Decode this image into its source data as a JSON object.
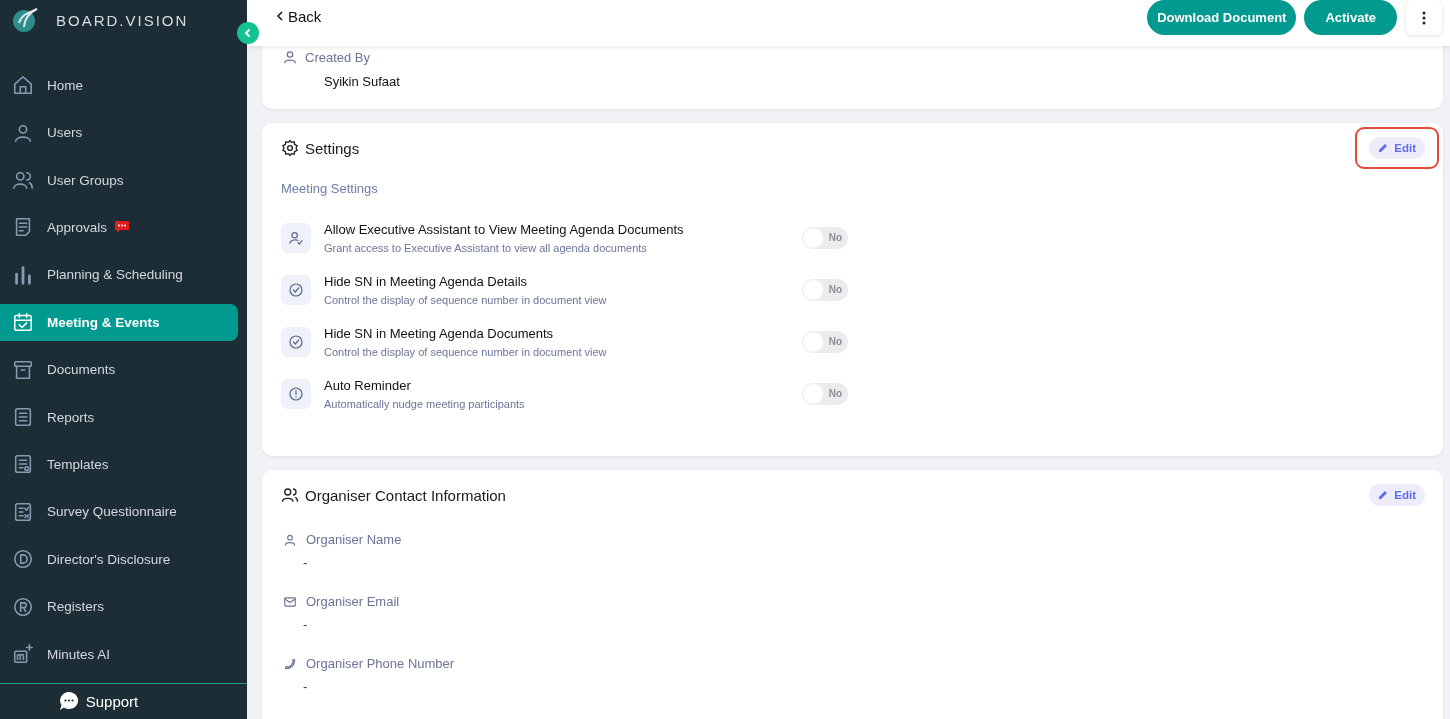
{
  "brand": {
    "name": "BOARD.VISION"
  },
  "sidebar": {
    "items": [
      {
        "label": "Home",
        "selected": false,
        "badge": false
      },
      {
        "label": "Users",
        "selected": false,
        "badge": false
      },
      {
        "label": "User Groups",
        "selected": false,
        "badge": false
      },
      {
        "label": "Approvals",
        "selected": false,
        "badge": true
      },
      {
        "label": "Planning & Scheduling",
        "selected": false,
        "badge": false
      },
      {
        "label": "Meeting & Events",
        "selected": true,
        "badge": false
      },
      {
        "label": "Documents",
        "selected": false,
        "badge": false
      },
      {
        "label": "Reports",
        "selected": false,
        "badge": false
      },
      {
        "label": "Templates",
        "selected": false,
        "badge": false
      },
      {
        "label": "Survey Questionnaire",
        "selected": false,
        "badge": false
      },
      {
        "label": "Director's Disclosure",
        "selected": false,
        "badge": false
      },
      {
        "label": "Registers",
        "selected": false,
        "badge": false
      },
      {
        "label": "Minutes AI",
        "selected": false,
        "badge": false
      }
    ],
    "support": "Support"
  },
  "header": {
    "back": "Back",
    "buttons": [
      "Download Document",
      "Activate"
    ]
  },
  "created": {
    "label": "Created By",
    "value": "Syikin Sufaat"
  },
  "settings": {
    "title": "Settings",
    "edit": "Edit",
    "highlighted": true,
    "section": "Meeting Settings",
    "rows": [
      {
        "title": "Allow Executive Assistant to View Meeting Agenda Documents",
        "subtitle": "Grant access to Executive Assistant to view all agenda documents",
        "on": false,
        "state": "No"
      },
      {
        "title": "Hide SN in Meeting Agenda Details",
        "subtitle": "Control the display of sequence number in document view",
        "on": false,
        "state": "No"
      },
      {
        "title": "Hide SN in Meeting Agenda Documents",
        "subtitle": "Control the display of sequence number in document view",
        "on": false,
        "state": "No"
      },
      {
        "title": "Auto Reminder",
        "subtitle": "Automatically nudge meeting participants",
        "on": false,
        "state": "No"
      }
    ]
  },
  "organiser": {
    "title": "Organiser Contact Information",
    "edit": "Edit",
    "highlighted": false,
    "fields": [
      {
        "label": "Organiser Name",
        "value": "-"
      },
      {
        "label": "Organiser Email",
        "value": "-"
      },
      {
        "label": "Organiser Phone Number",
        "value": "-"
      }
    ]
  }
}
